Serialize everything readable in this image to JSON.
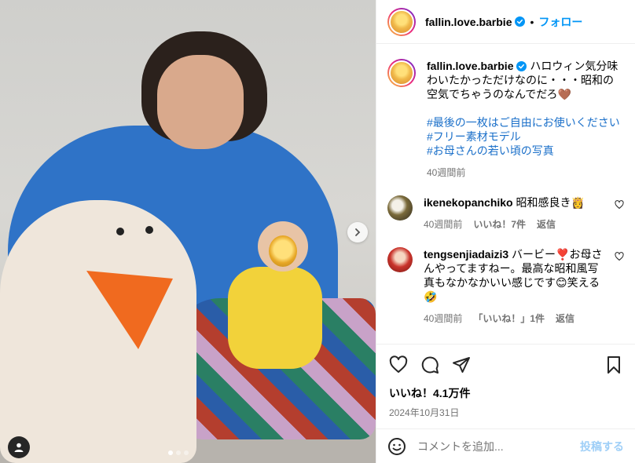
{
  "post": {
    "username": "fallin.love.barbie",
    "follow_label": "フォロー",
    "separator": "•"
  },
  "caption": {
    "username": "fallin.love.barbie",
    "text": "ハロウィン気分味わいたかっただけなのに・・・昭和の空気でちゃうのなんでだろ🤎",
    "hashtags": [
      "#最後の一枚はご自由にお使いください",
      "#フリー素材モデル",
      "#お母さんの若い頃の写真"
    ],
    "time": "40週間前"
  },
  "comments": [
    {
      "username": "ikenekopanchiko",
      "text": "昭和感良き👸",
      "time": "40週間前",
      "likes": "いいね！7件",
      "reply": "返信"
    },
    {
      "username": "tengsenjiadaizi3",
      "text": "バービー❣️お母さんやってますねー。最高な昭和風写真もなかなかいい感じです😊笑える🤣",
      "time": "40週間前",
      "likes": "「いいね！」1件",
      "reply": "返信"
    }
  ],
  "engagement": {
    "likes_label": "いいね！4.1万件",
    "date": "2024年10月31日"
  },
  "composer": {
    "placeholder": "コメントを追加...",
    "post_label": "投稿する"
  },
  "carousel": {
    "count": 3,
    "active": 1
  },
  "colors": {
    "accent": "#0095f6",
    "hashtag": "#1a6fc9",
    "muted": "#737373"
  },
  "icons": [
    "verified-icon",
    "chevron-right-icon",
    "user-tag-icon",
    "heart-icon",
    "comment-icon",
    "share-icon",
    "bookmark-icon",
    "emoji-icon"
  ]
}
